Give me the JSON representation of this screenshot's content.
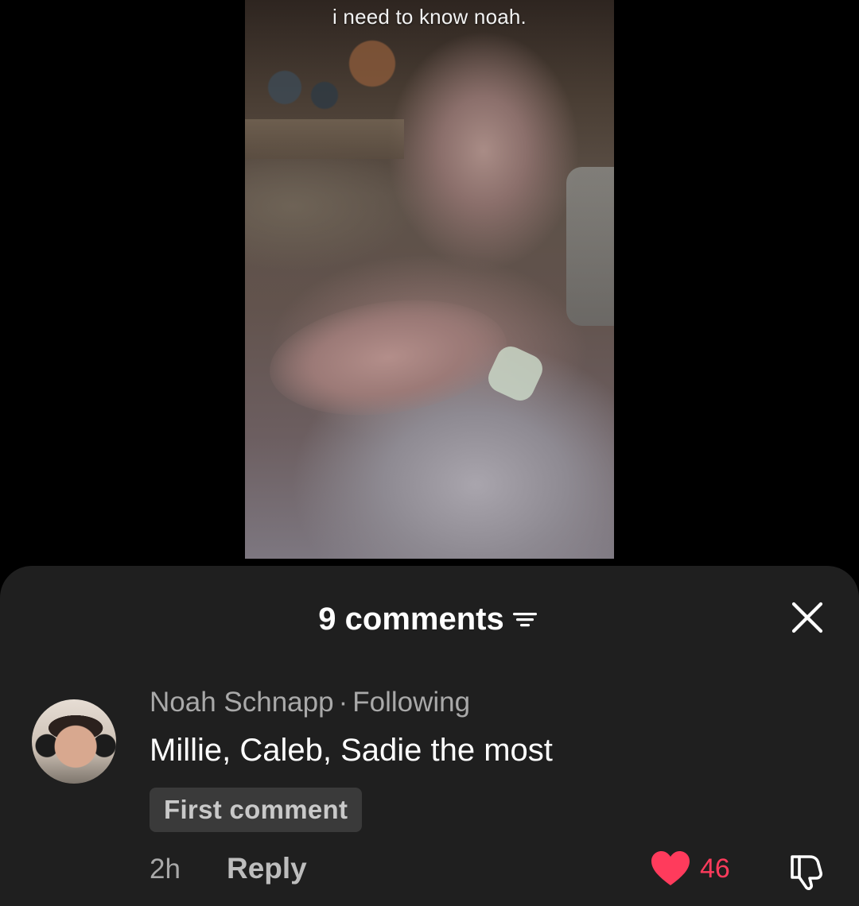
{
  "video": {
    "caption": "i need to know noah."
  },
  "comments_sheet": {
    "title": "9 comments",
    "filter_icon": "filter-icon",
    "close_icon": "close-icon",
    "comments": [
      {
        "author": "Noah Schnapp",
        "separator": "·",
        "relation": "Following",
        "text": "Millie, Caleb, Sadie the most",
        "badge": "First comment",
        "time": "2h",
        "reply_label": "Reply",
        "likes": "46",
        "liked": true,
        "like_color": "#ff3b5c"
      }
    ]
  },
  "colors": {
    "background": "#000000",
    "sheet": "#1f1f1f",
    "accent_like": "#ff3b5c"
  }
}
